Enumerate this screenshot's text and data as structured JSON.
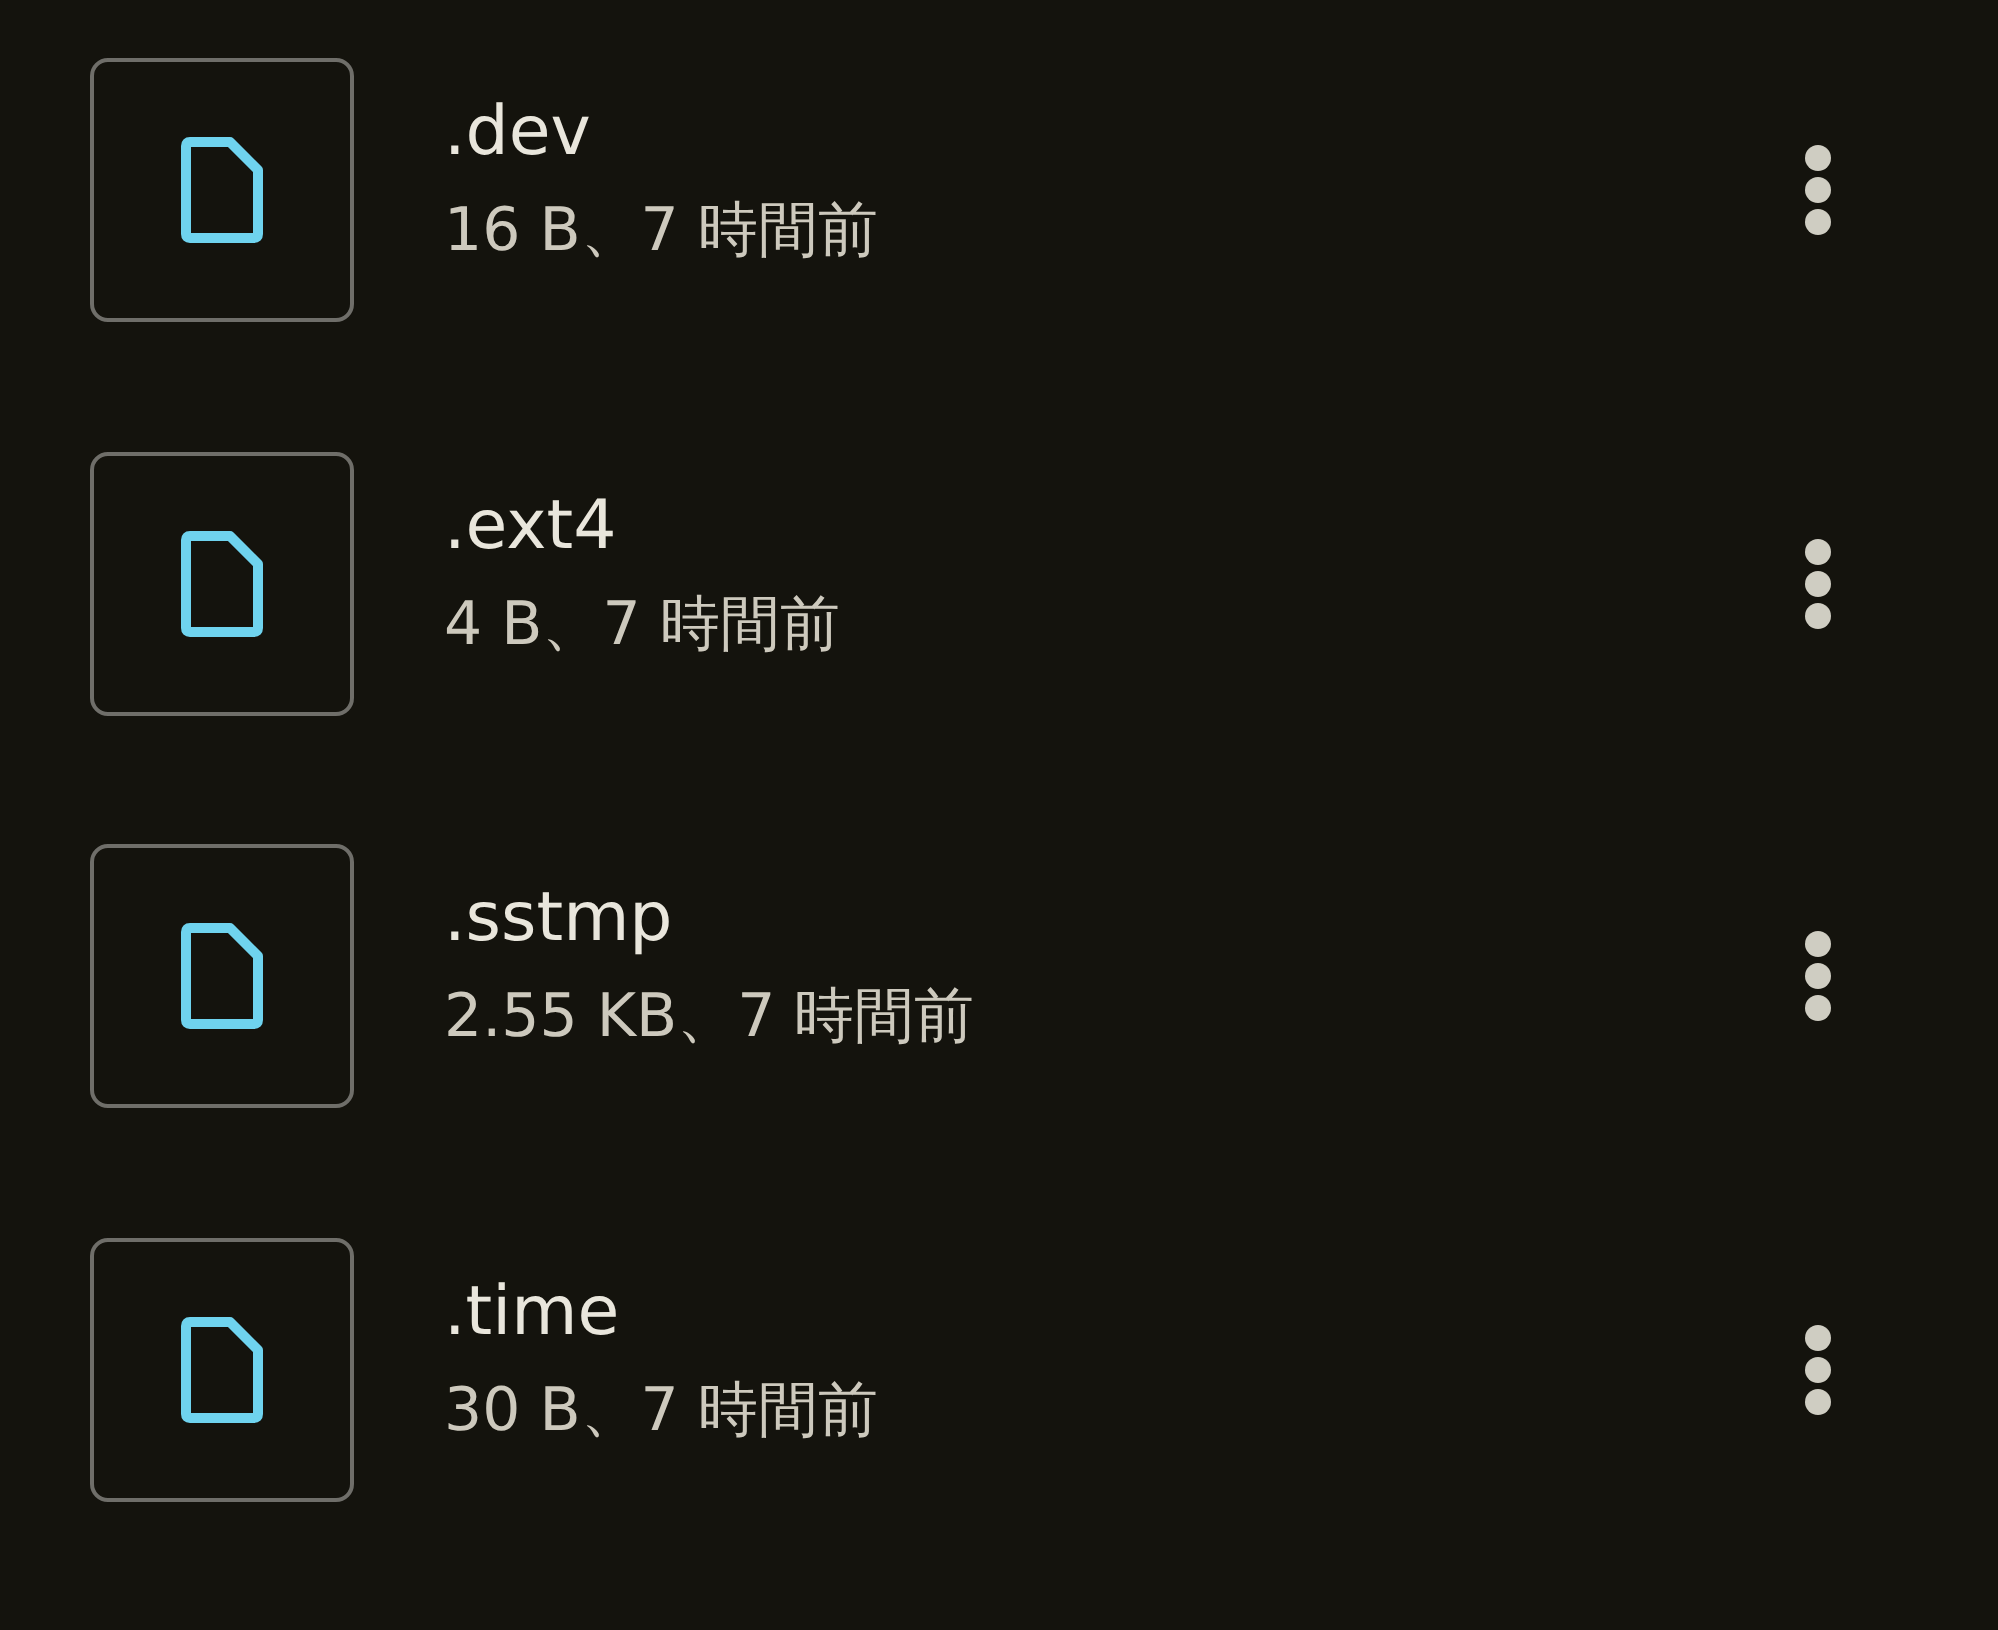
{
  "files": [
    {
      "name": ".dev",
      "details": "16 B、7 時間前"
    },
    {
      "name": ".ext4",
      "details": "4 B、7 時間前"
    },
    {
      "name": ".sstmp",
      "details": "2.55 KB、7 時間前"
    },
    {
      "name": ".time",
      "details": "30 B、7 時間前"
    }
  ]
}
